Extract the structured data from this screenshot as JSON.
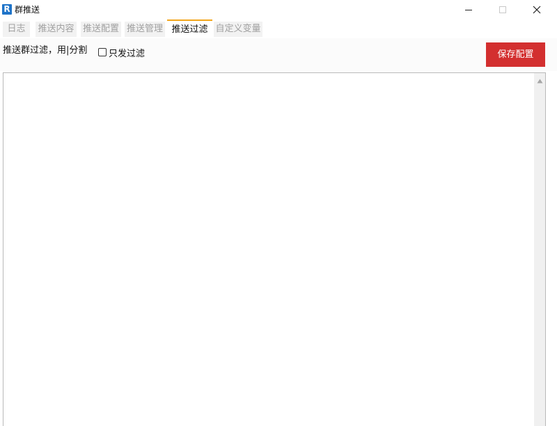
{
  "window": {
    "title": "群推送",
    "app_icon_glyph": "R",
    "icon_color": "#1e73c8"
  },
  "tabs": [
    {
      "label": "日志",
      "active": false
    },
    {
      "label": "推送内容",
      "active": false
    },
    {
      "label": "推送配置",
      "active": false
    },
    {
      "label": "推送管理",
      "active": false
    },
    {
      "label": "推送过滤",
      "active": true
    },
    {
      "label": "自定义变量",
      "active": false
    }
  ],
  "toolbar": {
    "filter_label": "推送群过滤，用|分割",
    "only_filter_label": "只发过滤",
    "only_filter_checked": false,
    "save_label": "保存配置",
    "save_color": "#d32f2f",
    "active_tab_accent": "#f2a51a"
  },
  "filter_textarea": {
    "value": ""
  }
}
